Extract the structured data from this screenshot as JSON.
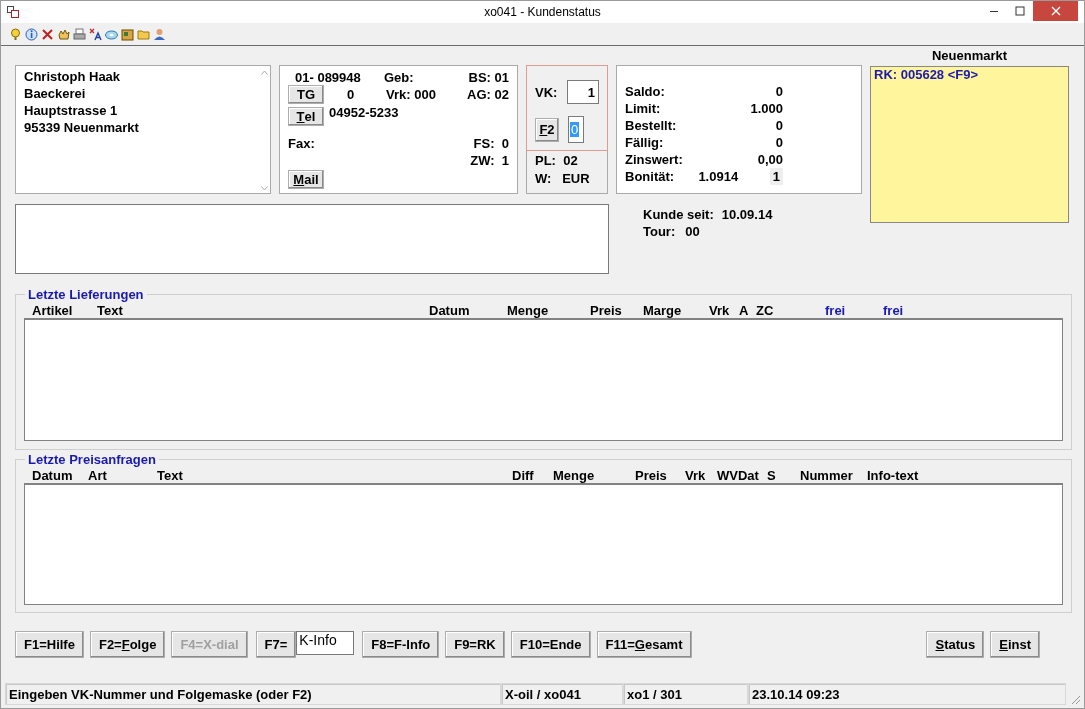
{
  "window": {
    "title": "xo041 - Kundenstatus"
  },
  "address": {
    "lines": [
      "Christoph Haak",
      "Baeckerei",
      "Hauptstrasse 1",
      "95339 Neuenmarkt"
    ]
  },
  "customer": {
    "number": "01- 089948",
    "geb": "Geb:",
    "bs": "BS: 01",
    "tg_button": {
      "label": "TG"
    },
    "tg_value": "0",
    "vrk": "Vrk: 000",
    "ag": "AG: 02",
    "tel_button": {
      "mnemonic": {
        "key": "T",
        "after": "el"
      }
    },
    "phone": "04952-5233",
    "fax": "Fax:",
    "fs": "FS:  0",
    "zw": "ZW:  1",
    "mail_button": {
      "mnemonic": {
        "key": "M",
        "after": "ail"
      }
    }
  },
  "vk": {
    "label": "VK:",
    "value": "1",
    "f2_button": {
      "mnemonic": {
        "key": "F",
        "after": "2"
      }
    },
    "mask_value": "0",
    "pl": "PL:  02",
    "w": "W:   EUR"
  },
  "account": {
    "rows": [
      {
        "label": "Saldo:",
        "value": "0"
      },
      {
        "label": "Limit:",
        "value": "1.000"
      },
      {
        "label": "Bestellt:",
        "value": "0"
      },
      {
        "label": "Fällig:",
        "value": "0"
      },
      {
        "label": "Zinswert:",
        "value": "0,00"
      }
    ],
    "rating_label": "Bonität:",
    "rating": "1.0914",
    "rating_badge": "1"
  },
  "since": {
    "label": "Kunde seit:",
    "value": "10.09.14"
  },
  "tour": {
    "label": "Tour:",
    "value": "00"
  },
  "location": "Neuenmarkt",
  "note": "RK: 005628 <F9>",
  "deliveries": {
    "title": "Letzte Lieferungen",
    "columns": [
      {
        "label": "Artikel",
        "color": "#000000"
      },
      {
        "label": "Text",
        "color": "#000000"
      },
      {
        "label": "Datum",
        "color": "#000000"
      },
      {
        "label": "Menge",
        "color": "#000000"
      },
      {
        "label": "Preis",
        "color": "#000000"
      },
      {
        "label": "Marge",
        "color": "#000000"
      },
      {
        "label": "Vrk",
        "color": "#000000"
      },
      {
        "label": "A",
        "color": "#000000"
      },
      {
        "label": "ZC",
        "color": "#000000"
      },
      {
        "label": "frei",
        "color": "#1a1ab0"
      },
      {
        "label": "frei",
        "color": "#1a1ab0"
      }
    ]
  },
  "inquiries": {
    "title": "Letzte Preisanfragen",
    "columns": [
      {
        "label": "Datum",
        "color": "#000000"
      },
      {
        "label": "Art",
        "color": "#000000"
      },
      {
        "label": "Text",
        "color": "#000000"
      },
      {
        "label": "Diff",
        "color": "#000000"
      },
      {
        "label": "Menge",
        "color": "#000000"
      },
      {
        "label": "Preis",
        "color": "#000000"
      },
      {
        "label": "Vrk",
        "color": "#000000"
      },
      {
        "label": "WVDat",
        "color": "#000000"
      },
      {
        "label": "S",
        "color": "#000000"
      },
      {
        "label": "Nummer",
        "color": "#000000"
      },
      {
        "label": "Info-text",
        "color": "#000000"
      }
    ]
  },
  "buttons": [
    {
      "kind": "button",
      "label": "F1=Hilfe",
      "disabled": false
    },
    {
      "kind": "button",
      "mnemonic": {
        "before": "F2=",
        "key": "F",
        "after": "olge"
      },
      "disabled": false
    },
    {
      "kind": "button",
      "label": "F4=X-dial",
      "disabled": true
    },
    {
      "kind": "field",
      "label": "F7=",
      "value": "K-Info"
    },
    {
      "kind": "button",
      "label": "F8=F-Info",
      "disabled": false
    },
    {
      "kind": "button",
      "label": "F9=RK",
      "disabled": false
    },
    {
      "kind": "button",
      "label": "F10=Ende",
      "disabled": false
    },
    {
      "kind": "button",
      "mnemonic": {
        "before": "F11=",
        "key": "G",
        "after": "esamt"
      },
      "disabled": false
    }
  ],
  "side_buttons": [
    {
      "mnemonic": {
        "key": "S",
        "after": "tatus"
      }
    },
    {
      "mnemonic": {
        "key": "E",
        "after": "inst"
      }
    }
  ],
  "status_bar": [
    "Eingeben VK-Nummer und Folgemaske (oder F2)",
    "X-oil / xo041",
    "xo1 / 301",
    "23.10.14 09:23"
  ]
}
